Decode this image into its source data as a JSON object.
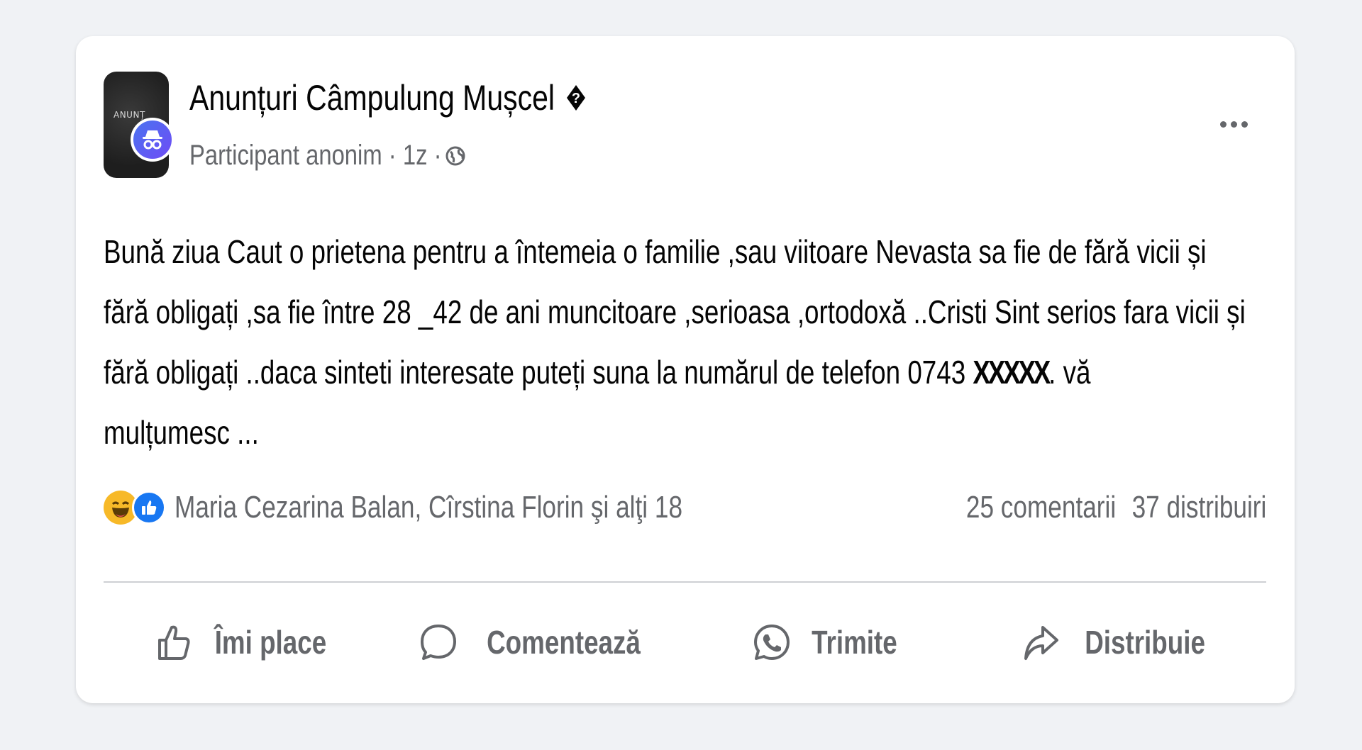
{
  "post": {
    "group_name": "Anunțuri Câmpulung Mușcel",
    "group_name_suffix": "�",
    "group_avatar_text": "ANUNȚ",
    "author": "Participant anonim",
    "separator_1": "·",
    "time": "1z",
    "separator_2": "·",
    "privacy_icon": "globe-icon",
    "body_lines": [
      "Bună ziua Caut o prietena pentru a întemeia o familie ,sau viitoare Nevasta sa fie de fără vicii și",
      "fără obligați ,sa fie între 28 _42 de ani muncitoare ,serioasa ,ortodoxă ..Cristi Sint serios fara vicii și",
      "fără obligați ..daca sinteti interesate puteți suna la numărul de telefon 0743 ",
      "mulțumesc ..."
    ],
    "phone_redacted": "XXXXX",
    "body_line3_tail": ". vă"
  },
  "reactions": {
    "icons": [
      "haha-icon",
      "like-icon"
    ],
    "names": "Maria Cezarina Balan, Cîrstina Florin şi alţi 18",
    "comments": "25 comentarii",
    "shares": "37 distribuiri"
  },
  "actions": {
    "like": "Îmi place",
    "comment": "Comentează",
    "send": "Trimite",
    "share": "Distribuie"
  },
  "colors": {
    "background": "#f0f2f5",
    "card": "#ffffff",
    "primary_text": "#050505",
    "secondary_text": "#65676b",
    "like_blue": "#1877f2",
    "haha_yellow": "#f7b928",
    "anon_purple": "#6f4cf5"
  }
}
